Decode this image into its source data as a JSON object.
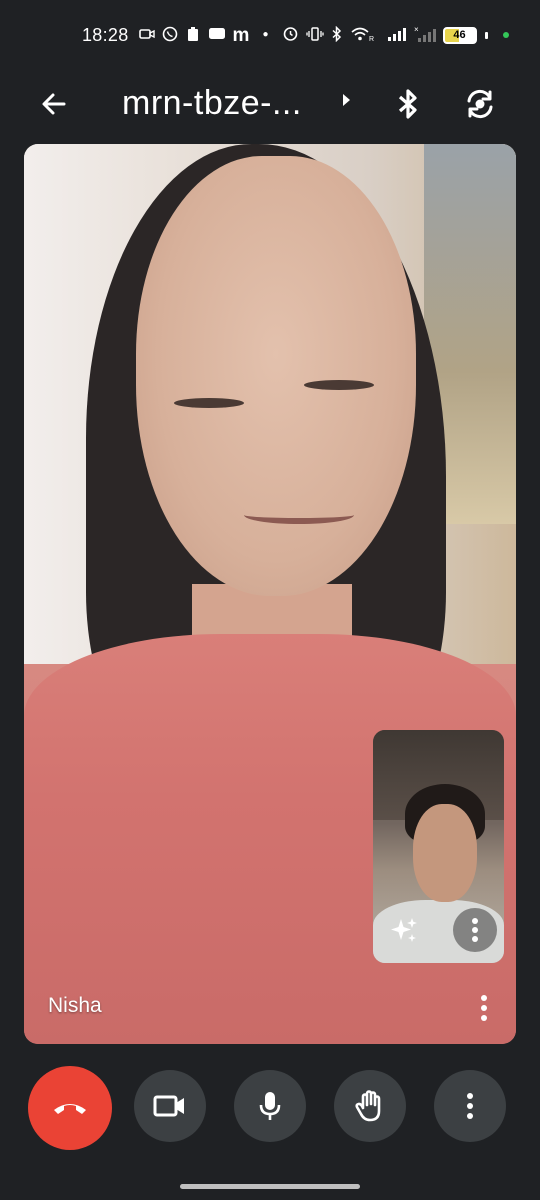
{
  "status_bar": {
    "time": "18:28",
    "battery": "46",
    "icons": [
      "camera-icon",
      "whatsapp-icon",
      "clipboard-icon",
      "message-icon",
      "m-app-icon",
      "dot-icon",
      "alarm-icon",
      "vibrate-icon",
      "bluetooth-icon",
      "wifi-icon",
      "signal-icon",
      "signal-x-icon",
      "battery-icon"
    ]
  },
  "top_bar": {
    "meeting_title": "mrn-tbze-...",
    "icons": [
      "back-arrow-icon",
      "chevron-right-icon",
      "bluetooth-audio-icon",
      "switch-camera-icon"
    ]
  },
  "main_video": {
    "participant_name": "Nisha"
  },
  "self_view": {
    "icons": [
      "sparkle-effects-icon",
      "more-vert-icon"
    ]
  },
  "controls": {
    "items": [
      {
        "name": "end-call-button",
        "icon": "phone-hangup-icon",
        "color": "#ea4335"
      },
      {
        "name": "camera-toggle-button",
        "icon": "videocam-icon",
        "color": "#3c4043"
      },
      {
        "name": "mic-toggle-button",
        "icon": "mic-icon",
        "color": "#3c4043"
      },
      {
        "name": "raise-hand-button",
        "icon": "hand-icon",
        "color": "#3c4043"
      },
      {
        "name": "more-options-button",
        "icon": "more-vert-icon",
        "color": "#3c4043"
      }
    ]
  },
  "colors": {
    "background": "#1f2124",
    "end_call": "#ea4335",
    "control_button": "#3c4043"
  }
}
